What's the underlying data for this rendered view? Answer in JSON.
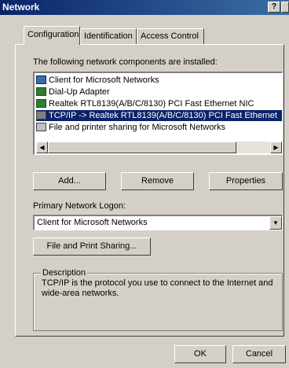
{
  "window": {
    "title": "Network",
    "help_button": "?"
  },
  "tabs": [
    {
      "label": "Configuration",
      "active": true
    },
    {
      "label": "Identification",
      "active": false
    },
    {
      "label": "Access Control",
      "active": false
    }
  ],
  "components": {
    "header": "The following network components are installed:",
    "items": [
      {
        "label": "Client for Microsoft Networks",
        "icon": "network-client-icon",
        "selected": false
      },
      {
        "label": "Dial-Up Adapter",
        "icon": "network-adapter-icon",
        "selected": false
      },
      {
        "label": "Realtek RTL8139(A/B/C/8130) PCI Fast Ethernet NIC",
        "icon": "network-adapter-icon",
        "selected": false
      },
      {
        "label": "TCP/IP -> Realtek RTL8139(A/B/C/8130) PCI Fast Ethernet",
        "icon": "protocol-icon",
        "selected": true
      },
      {
        "label": "File and printer sharing for Microsoft Networks",
        "icon": "file-sharing-icon",
        "selected": false
      }
    ]
  },
  "buttons": {
    "add": "Add...",
    "remove": "Remove",
    "properties": "Properties",
    "file_print_sharing": "File and Print Sharing...",
    "ok": "OK",
    "cancel": "Cancel"
  },
  "logon": {
    "label": "Primary Network Logon:",
    "value": "Client for Microsoft Networks"
  },
  "description": {
    "legend": "Description",
    "text": "TCP/IP is the protocol you use to connect to the Internet and wide-area networks."
  },
  "colors": {
    "titlebar": "#0a246a",
    "face": "#d4d0c8",
    "selection": "#0a246a"
  }
}
